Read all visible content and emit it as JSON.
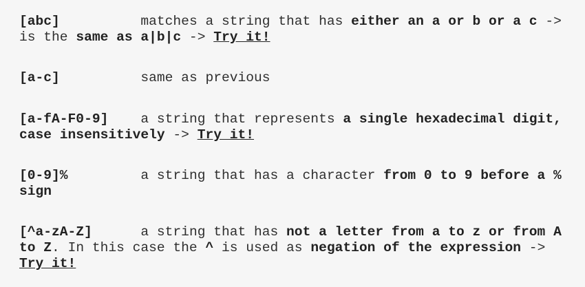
{
  "entries": [
    {
      "pattern": "[abc]",
      "gap": "          ",
      "t1": "matches a string that has ",
      "b1": "either an a or b or a c",
      "t2": " -> is the ",
      "b2": "same as a|b|c",
      "t3": " -> ",
      "link": "Try it!"
    },
    {
      "pattern": "[a-c]",
      "gap": "          ",
      "t1": "same as previous"
    },
    {
      "pattern": "[a-fA-F0-9]",
      "gap": "    ",
      "t1": "a string that represents ",
      "b1": "a single hexadecimal digit, case insensitively",
      "t2": " -> ",
      "link": "Try it!"
    },
    {
      "pattern": "[0-9]%",
      "gap": "         ",
      "t1": "a string that has a character ",
      "b1": "from 0 to 9 before a % sign"
    },
    {
      "pattern": "[^a-zA-Z]",
      "gap": "      ",
      "t1": "a string that has ",
      "b1": "not a letter from a to z or from A to Z",
      "t2": ". In this case the ",
      "b2": "^",
      "t3": " is used as ",
      "b3": "negation of the expression",
      "t4": " -> ",
      "link": "Try it!"
    }
  ]
}
